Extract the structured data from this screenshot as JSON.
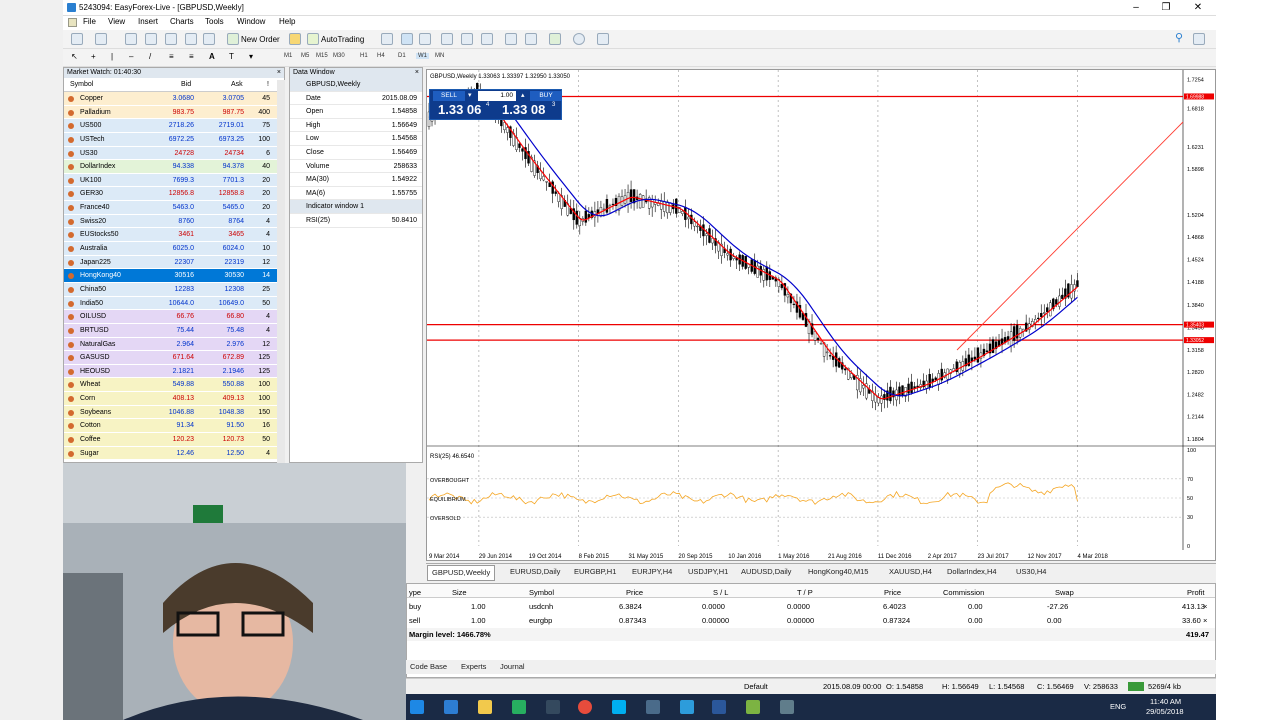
{
  "window": {
    "title": "5243094: EasyForex-Live - [GBPUSD,Weekly]"
  },
  "menu": [
    "File",
    "View",
    "Insert",
    "Charts",
    "Tools",
    "Window",
    "Help"
  ],
  "toolbar": {
    "new_order": "New Order",
    "autotrading": "AutoTrading",
    "timeframes": [
      "M1",
      "M5",
      "M15",
      "M30",
      "H1",
      "H4",
      "D1",
      "W1",
      "MN"
    ]
  },
  "market_watch": {
    "title": "Market Watch: 01:40:30",
    "headers": {
      "symbol": "Symbol",
      "bid": "Bid",
      "ask": "Ask",
      "spread": "!"
    },
    "rows": [
      {
        "s": "Copper",
        "b": "3.0680",
        "a": "3.0705",
        "p": "45",
        "c": "o"
      },
      {
        "s": "Palladium",
        "b": "983.75",
        "a": "987.75",
        "p": "400",
        "c": "o"
      },
      {
        "s": "US500",
        "b": "2718.26",
        "a": "2719.01",
        "p": "75",
        "c": "b"
      },
      {
        "s": "USTech",
        "b": "6972.25",
        "a": "6973.25",
        "p": "100",
        "c": "b"
      },
      {
        "s": "US30",
        "b": "24728",
        "a": "24734",
        "p": "6",
        "c": "b"
      },
      {
        "s": "DollarIndex",
        "b": "94.338",
        "a": "94.378",
        "p": "40",
        "c": "g"
      },
      {
        "s": "UK100",
        "b": "7699.3",
        "a": "7701.3",
        "p": "20",
        "c": "b"
      },
      {
        "s": "GER30",
        "b": "12856.8",
        "a": "12858.8",
        "p": "20",
        "c": "b"
      },
      {
        "s": "France40",
        "b": "5463.0",
        "a": "5465.0",
        "p": "20",
        "c": "b"
      },
      {
        "s": "Swiss20",
        "b": "8760",
        "a": "8764",
        "p": "4",
        "c": "b"
      },
      {
        "s": "EUStocks50",
        "b": "3461",
        "a": "3465",
        "p": "4",
        "c": "b"
      },
      {
        "s": "Australia",
        "b": "6025.0",
        "a": "6024.0",
        "p": "10",
        "c": "b"
      },
      {
        "s": "Japan225",
        "b": "22307",
        "a": "22319",
        "p": "12",
        "c": "b"
      },
      {
        "s": "HongKong40",
        "b": "30516",
        "a": "30530",
        "p": "14",
        "c": "s"
      },
      {
        "s": "China50",
        "b": "12283",
        "a": "12308",
        "p": "25",
        "c": "b"
      },
      {
        "s": "India50",
        "b": "10644.0",
        "a": "10649.0",
        "p": "50",
        "c": "b"
      },
      {
        "s": "OILUSD",
        "b": "66.76",
        "a": "66.80",
        "p": "4",
        "c": "p"
      },
      {
        "s": "BRTUSD",
        "b": "75.44",
        "a": "75.48",
        "p": "4",
        "c": "p"
      },
      {
        "s": "NaturalGas",
        "b": "2.964",
        "a": "2.976",
        "p": "12",
        "c": "p"
      },
      {
        "s": "GASUSD",
        "b": "671.64",
        "a": "672.89",
        "p": "125",
        "c": "p"
      },
      {
        "s": "HEOUSD",
        "b": "2.1821",
        "a": "2.1946",
        "p": "125",
        "c": "p"
      },
      {
        "s": "Wheat",
        "b": "549.88",
        "a": "550.88",
        "p": "100",
        "c": "y"
      },
      {
        "s": "Corn",
        "b": "408.13",
        "a": "409.13",
        "p": "100",
        "c": "y"
      },
      {
        "s": "Soybeans",
        "b": "1046.88",
        "a": "1048.38",
        "p": "150",
        "c": "y"
      },
      {
        "s": "Cotton",
        "b": "91.34",
        "a": "91.50",
        "p": "16",
        "c": "y"
      },
      {
        "s": "Coffee",
        "b": "120.23",
        "a": "120.73",
        "p": "50",
        "c": "y"
      },
      {
        "s": "Sugar",
        "b": "12.46",
        "a": "12.50",
        "p": "4",
        "c": "y"
      }
    ]
  },
  "data_window": {
    "title": "Data Window",
    "symbol": "GBPUSD,Weekly",
    "rows": [
      {
        "k": "Date",
        "v": "2015.08.09"
      },
      {
        "k": "Open",
        "v": "1.54858"
      },
      {
        "k": "High",
        "v": "1.56649"
      },
      {
        "k": "Low",
        "v": "1.54568"
      },
      {
        "k": "Close",
        "v": "1.56469"
      },
      {
        "k": "Volume",
        "v": "258633"
      },
      {
        "k": "MA(30)",
        "v": "1.54922"
      },
      {
        "k": "MA(6)",
        "v": "1.55755"
      },
      {
        "k": "Indicator window 1",
        "v": ""
      },
      {
        "k": "RSI(25)",
        "v": "50.8410"
      }
    ]
  },
  "trade_panel": {
    "sell": "SELL",
    "buy": "BUY",
    "lot": "1.00",
    "sell_big": "1.33 06",
    "sell_sup": "4",
    "buy_big": "1.33 08",
    "buy_sup": "3"
  },
  "chart": {
    "header": "GBPUSD,Weekly 1.33063 1.33397 1.32950 1.33050",
    "rsi_label": "RSI(25) 46.6540",
    "overbought": "OVERBOUGHT",
    "equilibrium": "EQUILIBRIUM",
    "oversold": "OVERSOLD"
  },
  "chart_data": {
    "type": "line",
    "title": "GBPUSD,Weekly",
    "x": [
      "9 Mar 2014",
      "29 Jun 2014",
      "19 Oct 2014",
      "8 Feb 2015",
      "31 May 2015",
      "20 Sep 2015",
      "10 Jan 2016",
      "1 May 2016",
      "21 Aug 2016",
      "11 Dec 2016",
      "2 Apr 2017",
      "23 Jul 2017",
      "12 Nov 2017",
      "4 Mar 2018"
    ],
    "series": [
      {
        "values": [
          1.668,
          1.71,
          1.605,
          1.51,
          1.548,
          1.53,
          1.46,
          1.42,
          1.31,
          1.24,
          1.265,
          1.305,
          1.35,
          1.415
        ]
      }
    ],
    "y_ticks": [
      1.7254,
      1.6818,
      1.6231,
      1.5898,
      1.5204,
      1.4868,
      1.4524,
      1.4188,
      1.384,
      1.3496,
      1.3158,
      1.282,
      1.2482,
      1.2144,
      1.1804
    ],
    "price_lines": [
      1.69988,
      1.35403,
      1.33052
    ],
    "rsi": {
      "name": "RSI(25)",
      "levels": [
        100,
        70,
        50,
        30,
        0
      ],
      "last": 46.654
    },
    "grid": false
  },
  "tabs": [
    "GBPUSD,Weekly",
    "EURUSD,Daily",
    "EURGBP,H1",
    "EURJPY,H4",
    "USDJPY,H1",
    "AUDUSD,Daily",
    "HongKong40,M15",
    "XAUUSD,H4",
    "DollarIndex,H4",
    "US30,H4"
  ],
  "terminal": {
    "headers": [
      "ype",
      "Size",
      "Symbol",
      "Price",
      "S / L",
      "T / P",
      "Price",
      "Commission",
      "Swap",
      "Profit"
    ],
    "rows": [
      [
        "buy",
        "1.00",
        "usdcnh",
        "6.3824",
        "0.0000",
        "0.0000",
        "6.4023",
        "0.00",
        "-27.26",
        "413.13"
      ],
      [
        "sell",
        "1.00",
        "eurgbp",
        "0.87343",
        "0.00000",
        "0.00000",
        "0.87324",
        "0.00",
        "0.00",
        "33.60"
      ]
    ],
    "margin_label": "Margin level: 1466.78%",
    "total_profit": "419.47"
  },
  "bottom_tabs": [
    "Code Base",
    "Experts",
    "Journal"
  ],
  "status": {
    "profile": "Default",
    "date": "2015.08.09 00:00",
    "open": "O: 1.54858",
    "high": "H: 1.56649",
    "low": "L: 1.54568",
    "close": "C: 1.56469",
    "vol": "V: 258633",
    "traffic": "5269/4 kb"
  },
  "taskbar": {
    "lang": "ENG",
    "time": "11:40 AM",
    "date": "29/05/2018"
  },
  "colors": {
    "ma_red": "#ff0000",
    "ma_blue": "#0000cc",
    "rsi": "#f5a623",
    "selected": "#0078d7"
  }
}
